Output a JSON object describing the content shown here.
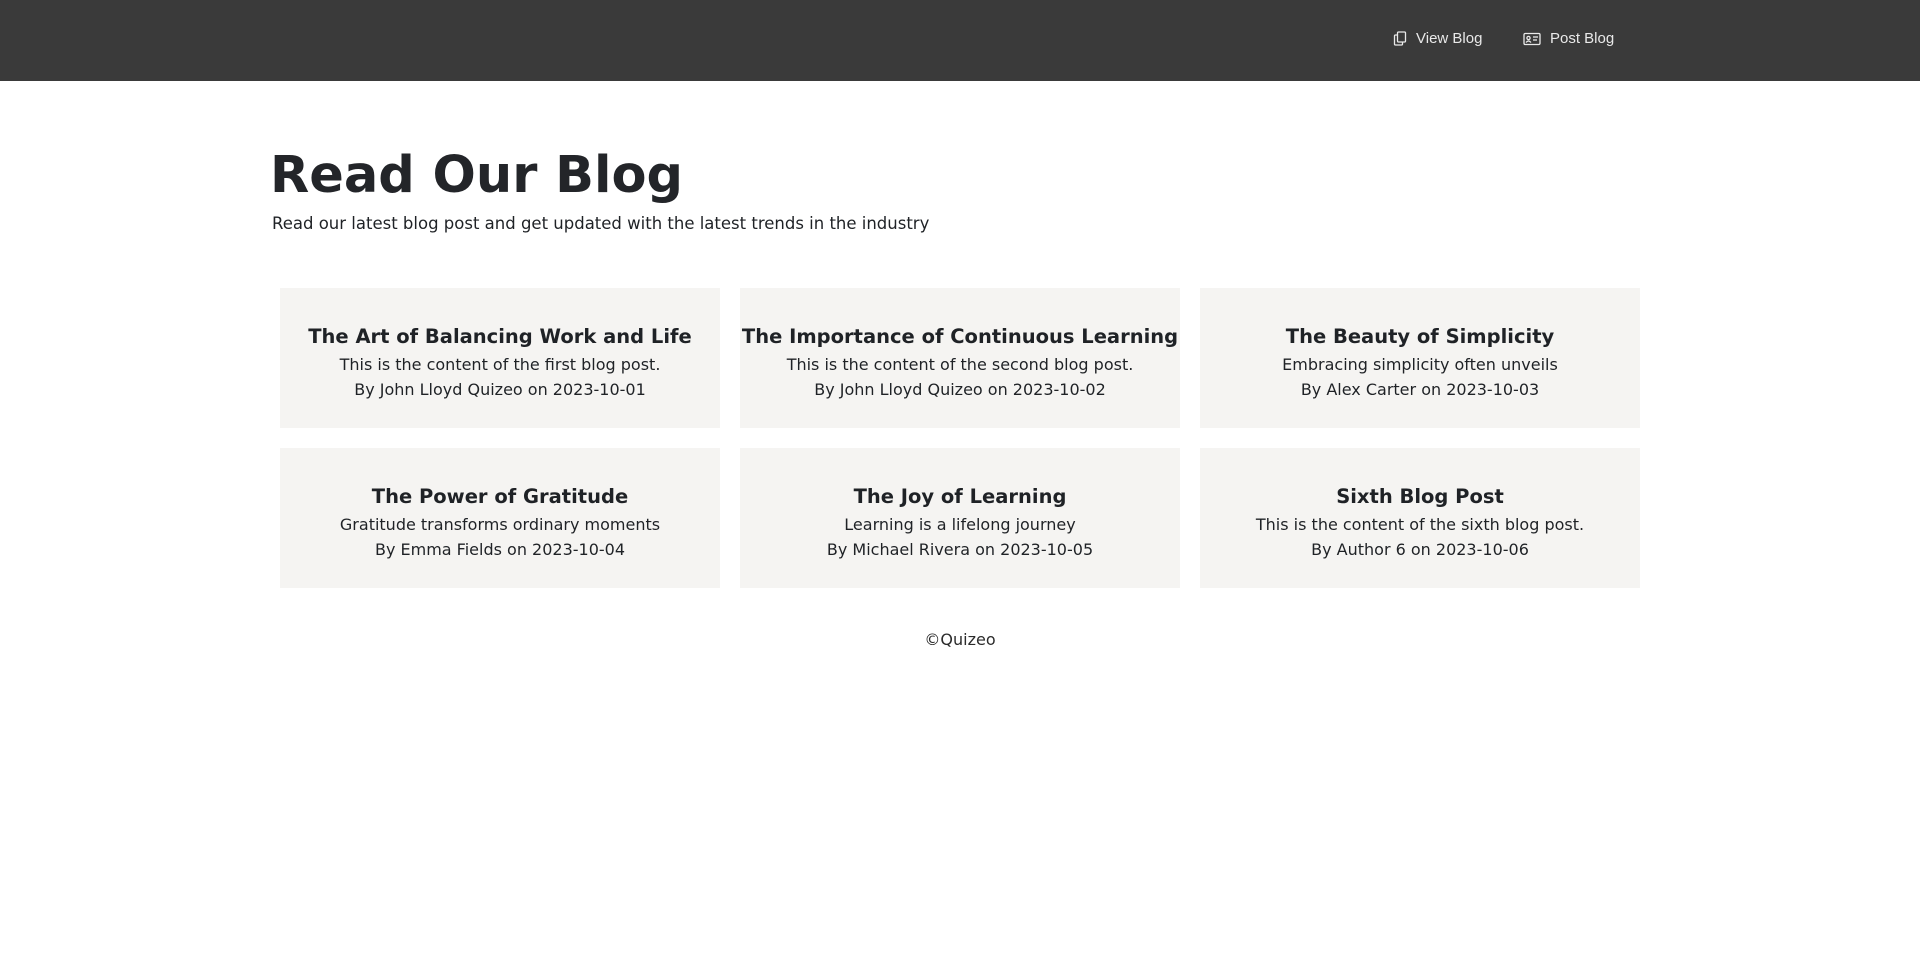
{
  "nav": {
    "view_blog": {
      "label": "View Blog",
      "icon": "copy-icon"
    },
    "post_blog": {
      "label": "Post Blog",
      "icon": "id-card-icon"
    }
  },
  "hero": {
    "title": "Read Our Blog",
    "subtitle": "Read our latest blog post and get updated with the latest trends in the industry"
  },
  "posts": [
    {
      "title": "The Art of Balancing Work and Life",
      "content": "This is the content of the first blog post.",
      "meta": "By John Lloyd Quizeo on 2023-10-01"
    },
    {
      "title": "The Importance of Continuous Learning",
      "content": "This is the content of the second blog post.",
      "meta": "By John Lloyd Quizeo on 2023-10-02"
    },
    {
      "title": "The Beauty of Simplicity",
      "content": "Embracing simplicity often unveils",
      "meta": "By Alex Carter on 2023-10-03"
    },
    {
      "title": "The Power of Gratitude",
      "content": "Gratitude transforms ordinary moments",
      "meta": "By Emma Fields on 2023-10-04"
    },
    {
      "title": "The Joy of Learning",
      "content": "Learning is a lifelong journey",
      "meta": "By Michael Rivera on 2023-10-05"
    },
    {
      "title": "Sixth Blog Post",
      "content": "This is the content of the sixth blog post.",
      "meta": "By Author 6 on 2023-10-06"
    }
  ],
  "footer": {
    "text": "©Quizeo"
  },
  "colors": {
    "topbar": "#3a3a3a",
    "card_bg": "#f5f4f2",
    "text": "#212529"
  }
}
